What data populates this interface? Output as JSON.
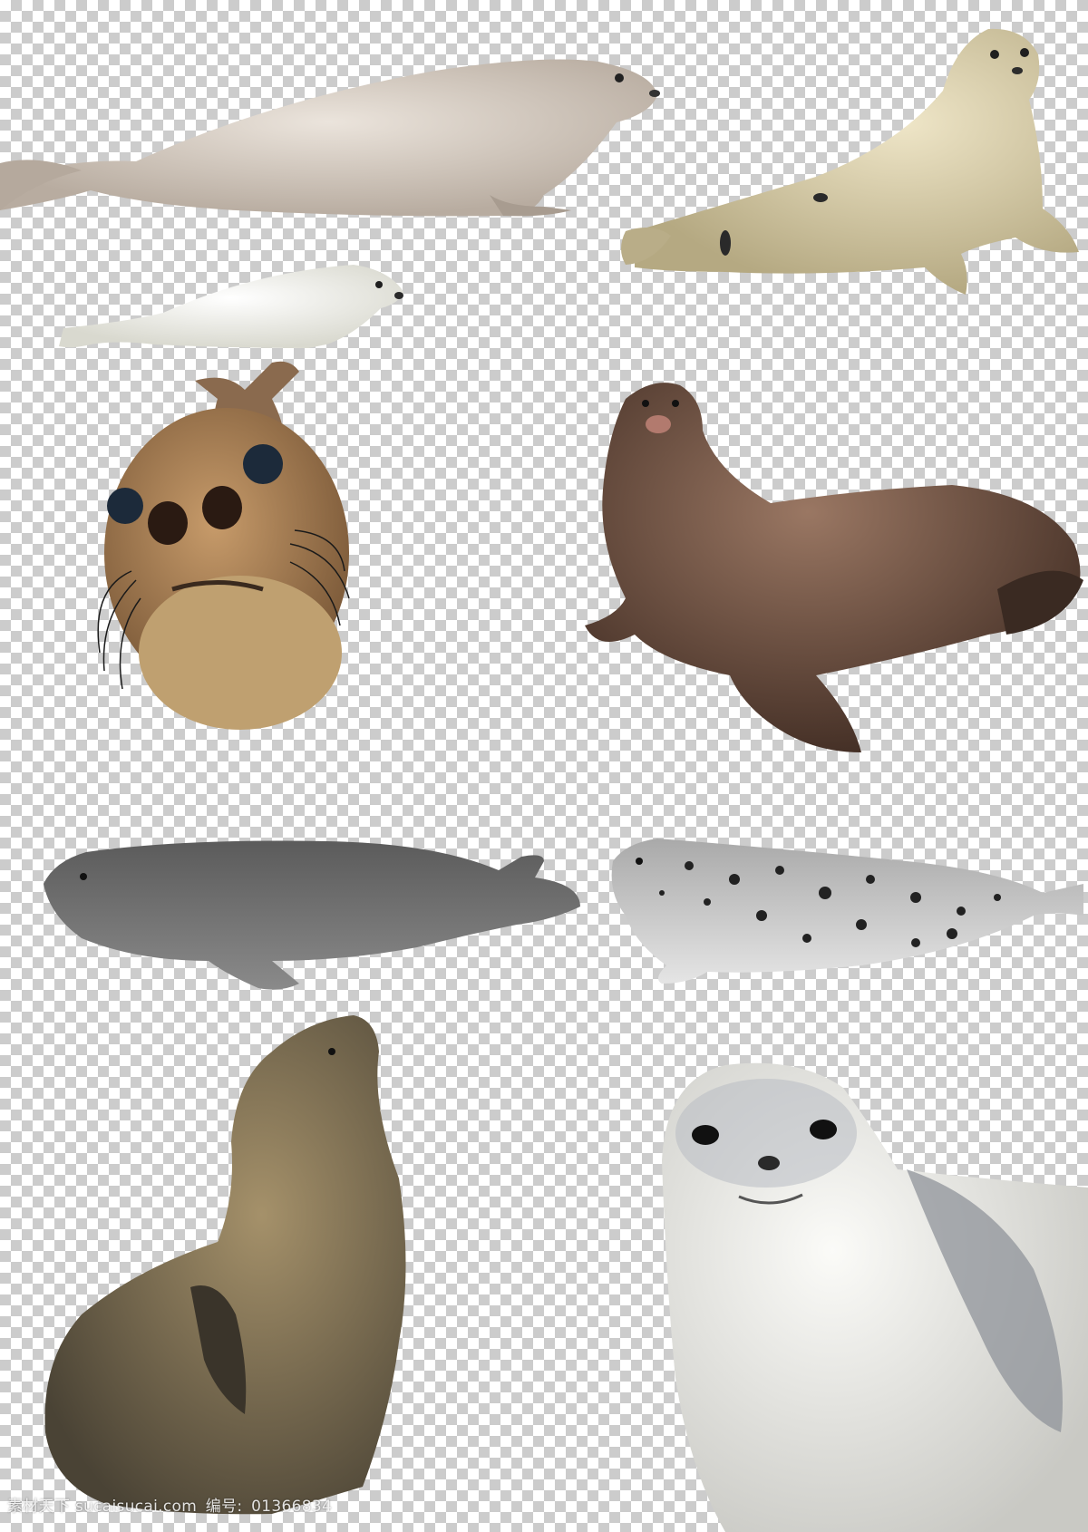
{
  "watermark": {
    "site": "素材天下 sucaisucai.com",
    "id_label": "编号:",
    "id_value": "01366834"
  },
  "colors": {
    "checker_light": "#ffffff",
    "checker_dark": "#cccccc",
    "spotted_seal_body": "#d8cfc6",
    "harp_seal_body": "#d9cfae",
    "white_pup_body": "#eeeee6",
    "brown_seal_face": "#b0875e",
    "sea_lion_body": "#7a5a48",
    "grey_seal_body": "#6f6f6f",
    "bw_spotted_seal_body": "#c9c9c9",
    "fur_seal_body": "#7e7560",
    "white_seal_body": "#e6e6e2"
  }
}
